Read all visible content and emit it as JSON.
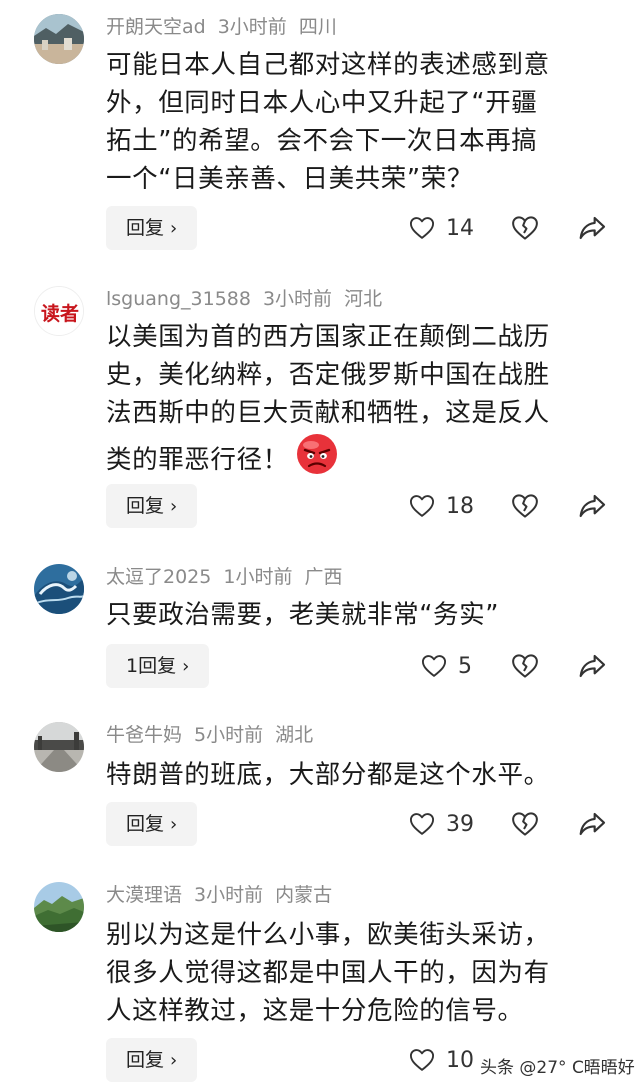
{
  "comments": [
    {
      "username": "开朗天空ad",
      "time": "3小时前",
      "location": "四川",
      "avatar": "landscape-avatar",
      "lines": [
        "可能日本人自己都对这样的表述感到意",
        "外，但同时日本人心中又升起了“开疆",
        "拓土”的希望。会不会下一次日本再搞",
        "一个“日美亲善、日美共荣”荣？"
      ],
      "reply_label": "回复",
      "likes": "14"
    },
    {
      "username": "lsguang_31588",
      "time": "3小时前",
      "location": "河北",
      "avatar": "duzhe-avatar",
      "avatar_text": "读者",
      "lines": [
        "以美国为首的西方国家正在颠倒二战历",
        "史，美化纳粹，否定俄罗斯中国在战胜",
        "法西斯中的巨大贡献和牺牲，这是反人",
        "类的罪恶行径！"
      ],
      "emoji": "angry-face-emoji",
      "reply_label": "回复",
      "likes": "18"
    },
    {
      "username": "太逗了2025",
      "time": "1小时前",
      "location": "广西",
      "avatar": "wave-avatar",
      "lines": [
        "只要政治需要，老美就非常“务实”"
      ],
      "reply_label": "1回复",
      "likes": "5"
    },
    {
      "username": "牛爸牛妈",
      "time": "5小时前",
      "location": "湖北",
      "avatar": "street-avatar",
      "lines": [
        "特朗普的班底，大部分都是这个水平。"
      ],
      "reply_label": "回复",
      "likes": "39"
    },
    {
      "username": "大漠理语",
      "time": "3小时前",
      "location": "内蒙古",
      "avatar": "mountain-avatar",
      "lines": [
        "别以为这是什么小事，欧美街头采访，",
        "很多人觉得这都是中国人干的，因为有",
        "人这样教过，这是十分危险的信号。"
      ],
      "reply_label": "回复",
      "likes": "10"
    }
  ],
  "watermark": "头条 @27° C晤晤好",
  "icons": {
    "like": "heart-outline-icon",
    "dislike": "broken-heart-icon",
    "share": "share-arrow-icon",
    "chevron": "chevron-right-icon"
  },
  "colors": {
    "meta_text": "#8a8a8a",
    "body_text": "#1a1a1a",
    "reply_bg": "#f3f3f3",
    "duzhe_red": "#c8161d"
  }
}
